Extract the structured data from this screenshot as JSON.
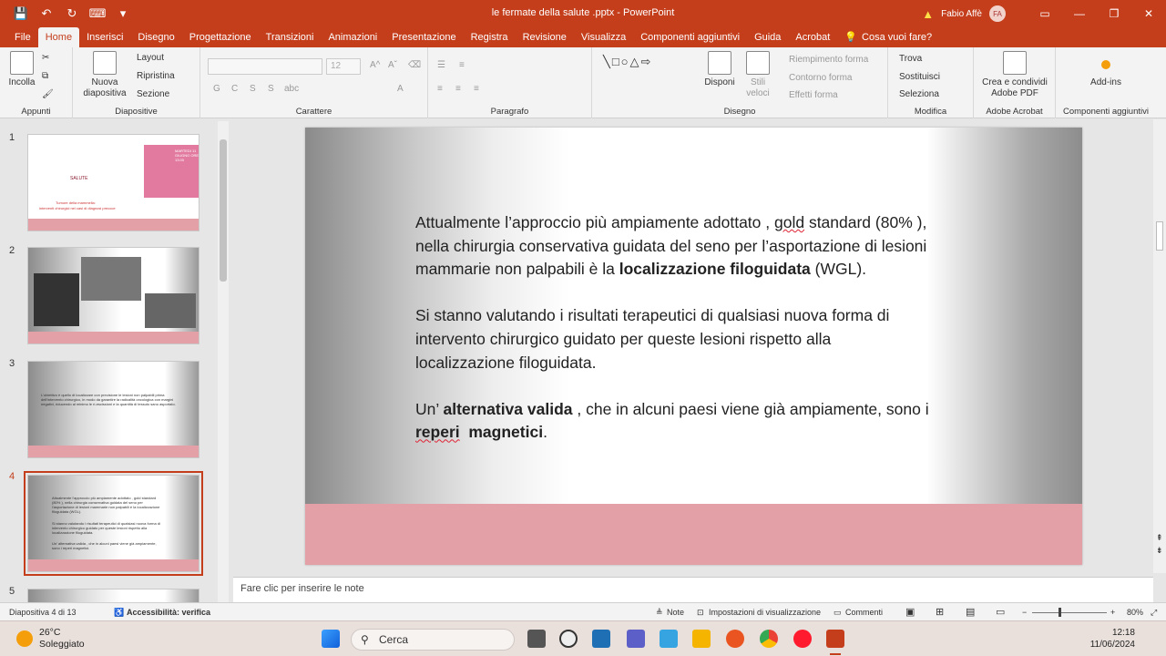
{
  "window": {
    "title": "le fermate della salute .pptx  -  PowerPoint",
    "user": "Fabio Affè",
    "initials": "FA"
  },
  "qat": [
    "💾",
    "↶",
    "↻",
    "⌨",
    "▾"
  ],
  "tabs": [
    "File",
    "Home",
    "Inserisci",
    "Disegno",
    "Progettazione",
    "Transizioni",
    "Animazioni",
    "Presentazione",
    "Registra",
    "Revisione",
    "Visualizza",
    "Componenti aggiuntivi",
    "Guida",
    "Acrobat"
  ],
  "tell_me": "Cosa vuoi fare?",
  "ribbon": {
    "appunti": {
      "label": "Appunti",
      "incolla": "Incolla"
    },
    "diapositive": {
      "label": "Diapositive",
      "nuova": "Nuova diapositiva",
      "layout": "Layout",
      "ripristina": "Ripristina",
      "sezione": "Sezione"
    },
    "carattere": {
      "label": "Carattere",
      "size": "12",
      "bold": "G",
      "italic": "C",
      "underline": "S",
      "shadow": "S",
      "strike": "abc"
    },
    "paragrafo": {
      "label": "Paragrafo"
    },
    "disegno": {
      "label": "Disegno",
      "disponi": "Disponi",
      "stili": "Stili veloci",
      "riempimento": "Riempimento forma",
      "contorno": "Contorno forma",
      "effetti": "Effetti forma"
    },
    "modifica": {
      "label": "Modifica",
      "trova": "Trova",
      "sostituisci": "Sostituisci",
      "seleziona": "Seleziona"
    },
    "acrobat": {
      "label": "Adobe Acrobat",
      "button": "Crea e condividi Adobe PDF"
    },
    "addins": {
      "label": "Componenti aggiuntivi",
      "button": "Add-ins"
    }
  },
  "thumbnails": {
    "numbers": [
      "1",
      "2",
      "3",
      "4",
      "5"
    ],
    "t1": {
      "org": "SALUTE",
      "line1": "Tumore della mammella:",
      "line2": "interventi chirurgici nei casi di diagnosi precoce",
      "poster": "MARTEDI 11 GIUGNO ORE 13.00"
    },
    "t3": "L'obiettivo è quello di localizzare con precisione le lesioni non palpabili prima dell'intervento chirurgico, in modo da garantire la radicalità oncologica con margini negativi, riducendo al minimo le ri-escissioni e la quantità di tessuto sano asportato.",
    "t4": {
      "p1": "Attualmente l'approccio più ampiamente adottato , gold standard (80% ), nella chirurgia conservativa guidata del seno per l'asportazione di lesioni mammarie non palpabili è la localizzazione filoguidata (WGL).",
      "p2": "Si stanno valutando i risultati terapeutici di qualsiasi nuova forma di intervento chirurgico guidato per queste lesioni rispetto alla localizzazione filoguidata.",
      "p3": "Un' alternativa valida , che in alcuni paesi viene già ampiamente, sono i reperi magnetici."
    }
  },
  "slide": {
    "p1a": "Attualmente l’approccio più ampiamente adottato , ",
    "p1_gold": "gold",
    "p1b": " standard (80% ), nella chirurgia conservativa guidata del seno per l’asportazione di lesioni mammarie non palpabili è la ",
    "p1_bold": "localizzazione filoguidata",
    "p1c": " (WGL).",
    "p2": "Si stanno valutando  i risultati terapeutici di qualsiasi nuova forma di intervento chirurgico guidato per queste lesioni rispetto alla localizzazione filoguidata.",
    "p3a": "Un’ ",
    "p3_bold": "alternativa valida",
    "p3b": " , che in alcuni paesi viene già ampiamente, sono i  ",
    "p3_reperi": "reperi",
    "p3_sp": "  ",
    "p3_magn": "magnetici",
    "p3c": "."
  },
  "notes_placeholder": "Fare clic per inserire le note",
  "status": {
    "slide": "Diapositiva 4 di 13",
    "access": "Accessibilità: verifica",
    "note": "Note",
    "impostazioni": "Impostazioni di visualizzazione",
    "commenti": "Commenti",
    "zoom": "80%"
  },
  "taskbar": {
    "temp": "26°C",
    "cond": "Soleggiato",
    "search": "Cerca",
    "time": "12:18",
    "date": "11/06/2024"
  }
}
